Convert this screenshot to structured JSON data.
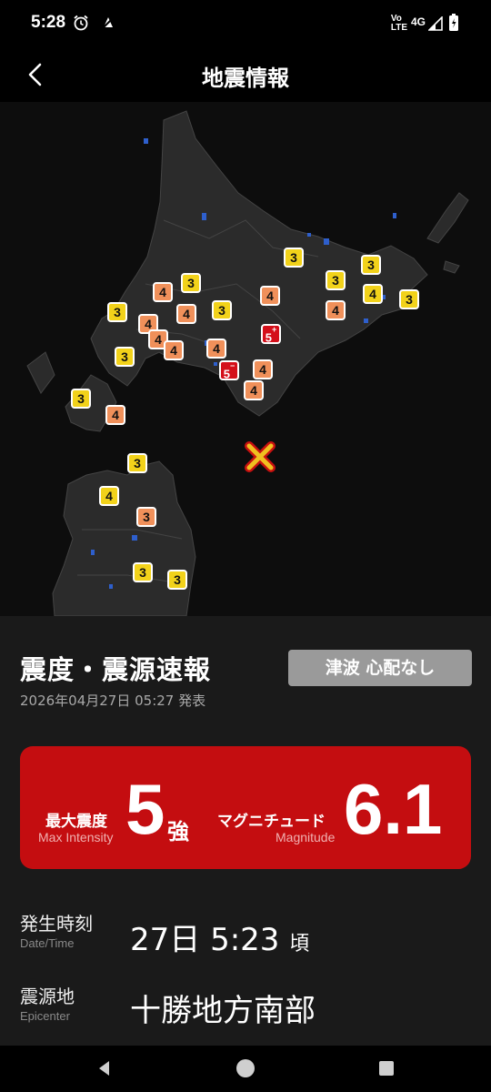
{
  "status_bar": {
    "time": "5:28",
    "network_top": "Vo",
    "network_bottom": "LTE",
    "network_type": "4G",
    "icons": [
      "alarm-icon",
      "notification-icon",
      "wifi-icon",
      "signal-icon",
      "battery-icon"
    ]
  },
  "header": {
    "title": "地震情報",
    "back_icon": "chevron-left-icon"
  },
  "map": {
    "intensity_colors": {
      "3": "#f2d21a",
      "4": "#f0905a",
      "5": "#d40f1a"
    },
    "epicenter_icon": "x-mark-icon",
    "markers": [
      "3",
      "4",
      "3",
      "3",
      "4",
      "4",
      "3",
      "4",
      "4",
      "3",
      "3",
      "4",
      "3",
      "4",
      "4",
      "3",
      "4",
      "5+",
      "5-",
      "4",
      "4",
      "3",
      "4",
      "3",
      "3",
      "4",
      "3",
      "3"
    ]
  },
  "report": {
    "title": "震度・震源速報",
    "tsunami_label": "津波 心配なし",
    "issued": "2026年04月27日 05:27 発表",
    "max_intensity_jp": "最大震度",
    "max_intensity_en": "Max Intensity",
    "max_intensity_value": "5",
    "max_intensity_suffix": "強",
    "magnitude_jp": "マグニチュード",
    "magnitude_en": "Magnitude",
    "magnitude_value": "6.1",
    "datetime_label_jp": "発生時刻",
    "datetime_label_en": "Date/Time",
    "datetime_value": "27日 5:23",
    "datetime_suffix": "頃",
    "epicenter_label_jp": "震源地",
    "epicenter_label_en": "Epicenter",
    "epicenter_value": "十勝地方南部"
  },
  "nav": {
    "icons": [
      "back-triangle-icon",
      "home-circle-icon",
      "recents-square-icon"
    ]
  }
}
